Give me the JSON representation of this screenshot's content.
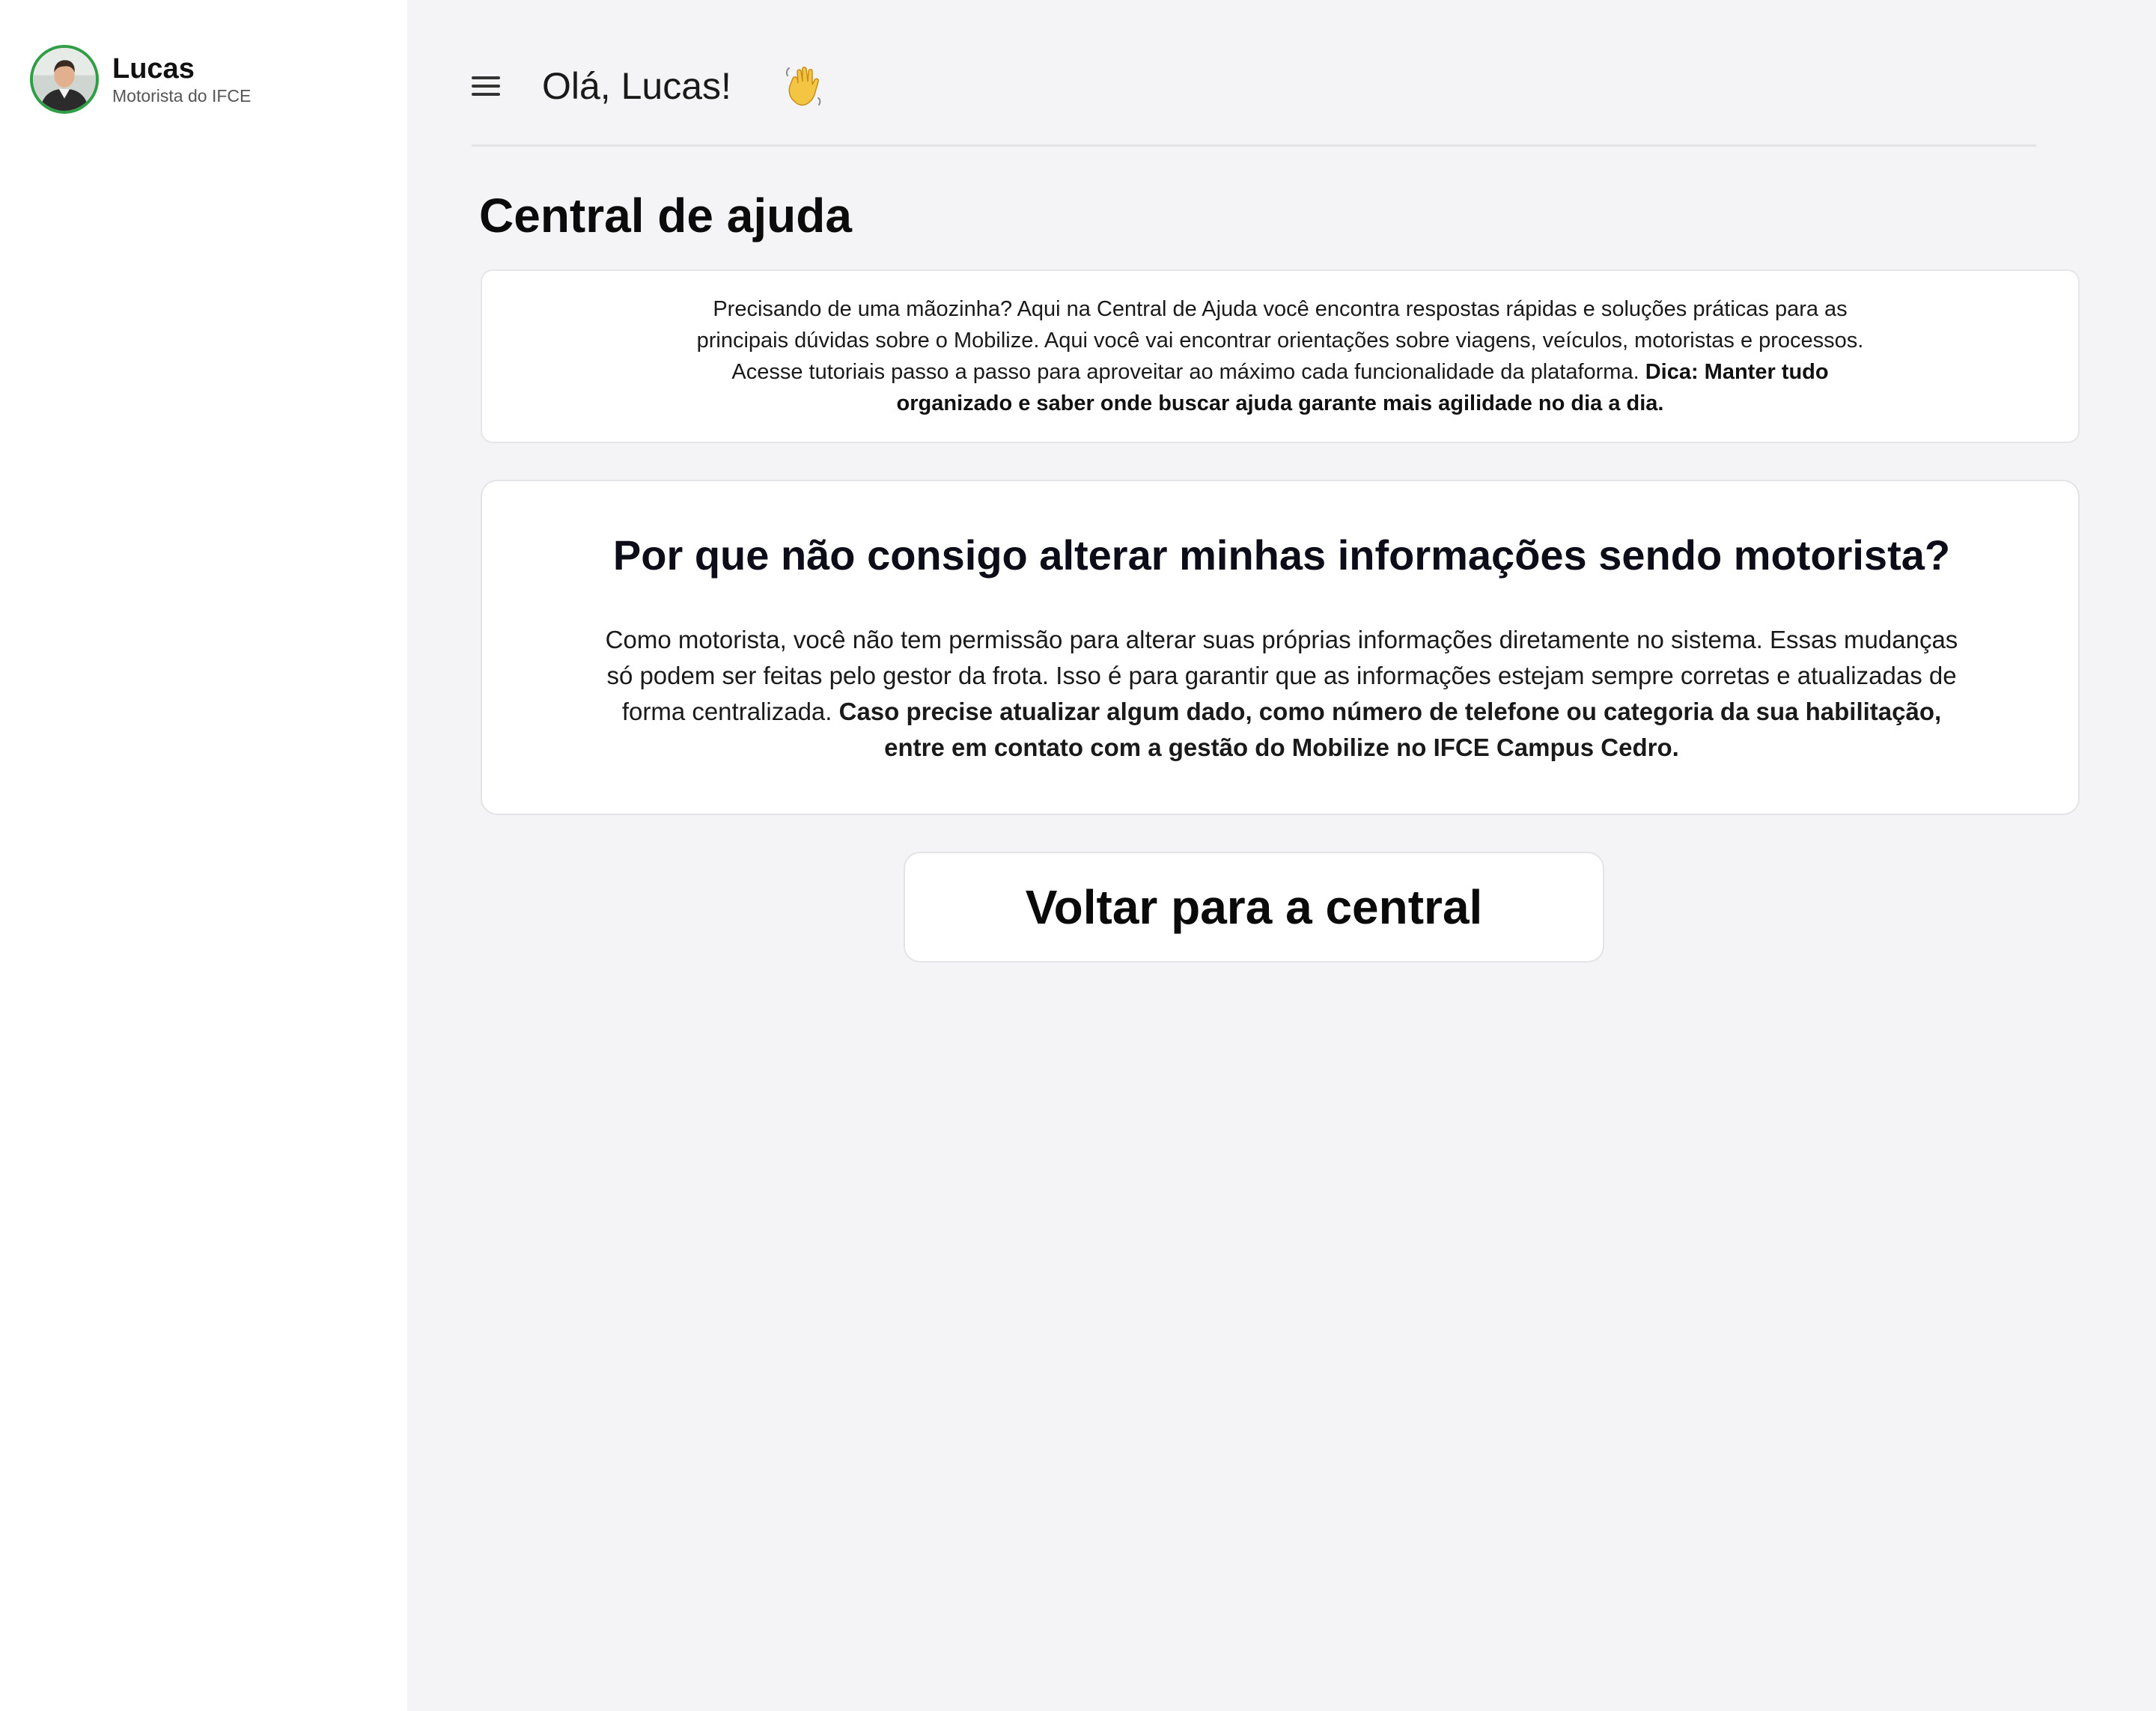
{
  "sidebar": {
    "profile": {
      "name": "Lucas",
      "role": "Motorista do IFCE"
    }
  },
  "header": {
    "greeting": "Olá, Lucas!",
    "menu_icon": "hamburger-menu-icon",
    "wave_icon": "waving-hand-emoji"
  },
  "main": {
    "title": "Central de ajuda",
    "intro": {
      "text": "Precisando de uma mãozinha? Aqui na Central de Ajuda você encontra respostas rápidas e soluções práticas para as principais dúvidas sobre o Mobilize. Aqui você vai encontrar orientações sobre viagens, veículos, motoristas e processos. Acesse tutoriais passo a passo para aproveitar ao máximo cada funcionalidade da plataforma. ",
      "tip": "Dica: Manter tudo organizado e saber onde buscar ajuda garante mais agilidade no dia a dia."
    },
    "faq": {
      "question": "Por que não consigo alterar minhas informações sendo motorista?",
      "answer": "Como motorista, você não tem permissão para alterar suas próprias informações diretamente no sistema. Essas mudanças só podem ser feitas pelo gestor da frota. Isso é para garantir que as informações estejam sempre corretas e atualizadas de forma centralizada. ",
      "answer_bold": "Caso precise atualizar algum dado, como número de telefone ou categoria da sua habilitação, entre em contato com a gestão do Mobilize no IFCE Campus Cedro."
    },
    "back_button": "Voltar para a central"
  },
  "colors": {
    "background": "#f4f4f6",
    "sidebar": "#ffffff",
    "avatar_ring": "#2f9e44",
    "text": "#111111"
  }
}
